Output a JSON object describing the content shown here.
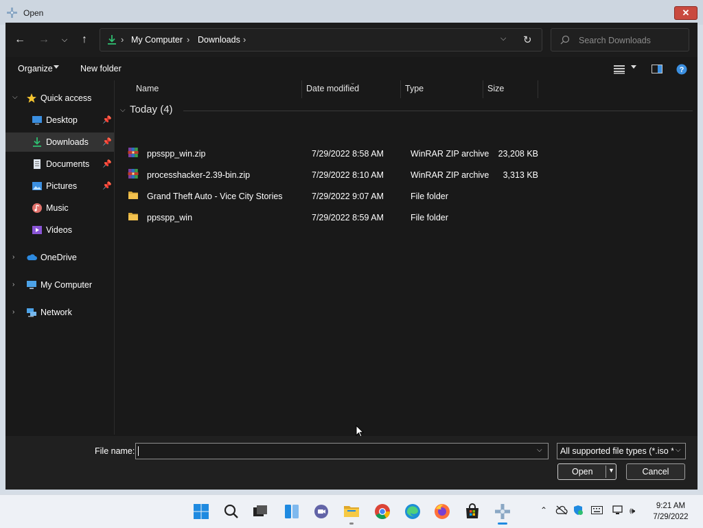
{
  "window": {
    "title": "Open",
    "close_label": "✕"
  },
  "address": {
    "crumbs": [
      "My Computer",
      "Downloads"
    ],
    "search_placeholder": "Search Downloads"
  },
  "toolbar": {
    "organize_label": "Organize",
    "new_folder_label": "New folder"
  },
  "sidebar": {
    "items": [
      {
        "label": "Quick access",
        "icon": "star-icon",
        "pinned": false
      },
      {
        "label": "Desktop",
        "icon": "desktop-icon",
        "pinned": true
      },
      {
        "label": "Downloads",
        "icon": "download-icon",
        "pinned": true,
        "selected": true
      },
      {
        "label": "Documents",
        "icon": "documents-icon",
        "pinned": true
      },
      {
        "label": "Pictures",
        "icon": "pictures-icon",
        "pinned": true
      },
      {
        "label": "Music",
        "icon": "music-icon",
        "pinned": false
      },
      {
        "label": "Videos",
        "icon": "videos-icon",
        "pinned": false
      },
      {
        "label": "OneDrive",
        "icon": "cloud-icon",
        "pinned": false
      },
      {
        "label": "My Computer",
        "icon": "computer-icon",
        "pinned": false
      },
      {
        "label": "Network",
        "icon": "network-icon",
        "pinned": false
      }
    ]
  },
  "columns": {
    "name": "Name",
    "date": "Date modified",
    "type": "Type",
    "size": "Size"
  },
  "group": {
    "title": "Today (4)"
  },
  "files": [
    {
      "name": "ppsspp_win.zip",
      "date": "7/29/2022 8:58 AM",
      "type": "WinRAR ZIP archive",
      "size": "23,208 KB",
      "icon": "zip-archive-icon"
    },
    {
      "name": "processhacker-2.39-bin.zip",
      "date": "7/29/2022 8:10 AM",
      "type": "WinRAR ZIP archive",
      "size": "3,313 KB",
      "icon": "zip-archive-icon"
    },
    {
      "name": "Grand Theft Auto - Vice City Stories",
      "date": "7/29/2022 9:07 AM",
      "type": "File folder",
      "size": "",
      "icon": "folder-icon"
    },
    {
      "name": "ppsspp_win",
      "date": "7/29/2022 8:59 AM",
      "type": "File folder",
      "size": "",
      "icon": "folder-icon"
    }
  ],
  "footer": {
    "file_name_label": "File name:",
    "file_name_value": "",
    "file_type_value": "All supported file types (*.iso *.cso",
    "open_label": "Open",
    "cancel_label": "Cancel"
  },
  "taskbar": {
    "time": "9:21 AM",
    "date": "7/29/2022"
  },
  "colors": {
    "accent_blue": "#3b8fe0",
    "folder_yellow": "#f2c14e",
    "download_green": "#2fbf71"
  }
}
